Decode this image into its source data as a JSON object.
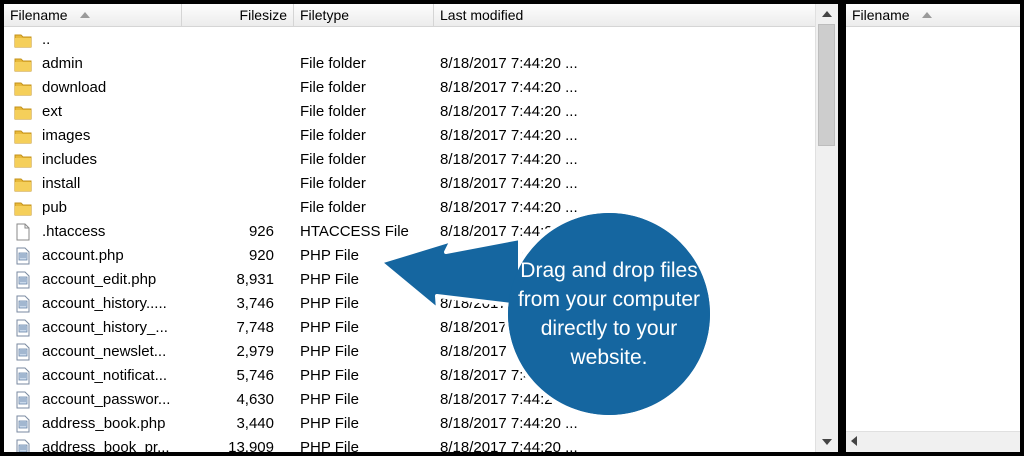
{
  "left_pane": {
    "columns": {
      "filename": "Filename",
      "filesize": "Filesize",
      "filetype": "Filetype",
      "last_modified": "Last modified"
    },
    "rows": [
      {
        "icon": "folder-icon",
        "name": "..",
        "size": "",
        "type": "",
        "modified": ""
      },
      {
        "icon": "folder-icon",
        "name": "admin",
        "size": "",
        "type": "File folder",
        "modified": "8/18/2017 7:44:20 ..."
      },
      {
        "icon": "folder-icon",
        "name": "download",
        "size": "",
        "type": "File folder",
        "modified": "8/18/2017 7:44:20 ..."
      },
      {
        "icon": "folder-icon",
        "name": "ext",
        "size": "",
        "type": "File folder",
        "modified": "8/18/2017 7:44:20 ..."
      },
      {
        "icon": "folder-icon",
        "name": "images",
        "size": "",
        "type": "File folder",
        "modified": "8/18/2017 7:44:20 ..."
      },
      {
        "icon": "folder-icon",
        "name": "includes",
        "size": "",
        "type": "File folder",
        "modified": "8/18/2017 7:44:20 ..."
      },
      {
        "icon": "folder-icon",
        "name": "install",
        "size": "",
        "type": "File folder",
        "modified": "8/18/2017 7:44:20 ..."
      },
      {
        "icon": "folder-icon",
        "name": "pub",
        "size": "",
        "type": "File folder",
        "modified": "8/18/2017 7:44:20 ..."
      },
      {
        "icon": "file-icon",
        "name": ".htaccess",
        "size": "926",
        "type": "HTACCESS File",
        "modified": "8/18/2017 7:44:20 ..."
      },
      {
        "icon": "php-file-icon",
        "name": "account.php",
        "size": "920",
        "type": "PHP File",
        "modified": "8/18/2017 7:44:20 ..."
      },
      {
        "icon": "php-file-icon",
        "name": "account_edit.php",
        "size": "8,931",
        "type": "PHP File",
        "modified": "8/18/2017 7:44:20 ..."
      },
      {
        "icon": "php-file-icon",
        "name": "account_history.....",
        "size": "3,746",
        "type": "PHP File",
        "modified": "8/18/2017 7:44:20 ..."
      },
      {
        "icon": "php-file-icon",
        "name": "account_history_...",
        "size": "7,748",
        "type": "PHP File",
        "modified": "8/18/2017 7:44:20 ..."
      },
      {
        "icon": "php-file-icon",
        "name": "account_newslet...",
        "size": "2,979",
        "type": "PHP File",
        "modified": "8/18/2017 7:44:20 ..."
      },
      {
        "icon": "php-file-icon",
        "name": "account_notificat...",
        "size": "5,746",
        "type": "PHP File",
        "modified": "8/18/2017 7:44:20 ..."
      },
      {
        "icon": "php-file-icon",
        "name": "account_passwor...",
        "size": "4,630",
        "type": "PHP File",
        "modified": "8/18/2017 7:44:20 ..."
      },
      {
        "icon": "php-file-icon",
        "name": "address_book.php",
        "size": "3,440",
        "type": "PHP File",
        "modified": "8/18/2017 7:44:20 ..."
      },
      {
        "icon": "php-file-icon",
        "name": "address_book_pr...",
        "size": "13,909",
        "type": "PHP File",
        "modified": "8/18/2017 7:44:20 ..."
      }
    ]
  },
  "right_pane": {
    "columns": {
      "filename": "Filename"
    }
  },
  "callout": {
    "text": "Drag and drop files from your computer directly to your website.",
    "color": "#1566a0"
  }
}
